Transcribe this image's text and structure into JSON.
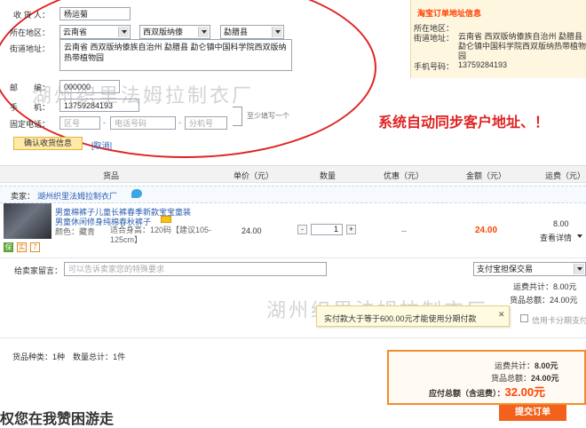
{
  "address_form": {
    "receiver_label": "收 货 人：",
    "receiver_value": "杨运菊",
    "region_label": "所在地区：",
    "province": "云南省",
    "prefecture": "西双版纳傣",
    "county": "勐腊县",
    "street_label": "街道地址：",
    "street_value": "云南省 西双版纳傣族自治州 勐腊县 勐仑镇中国科学院西双版纳热带植物园",
    "postcode_label": "邮　　编：",
    "postcode_value": "000000",
    "mobile_label": "手　　机：",
    "mobile_value": "13759284193",
    "phone_label": "固定电话：",
    "area_code_placeholder": "区号",
    "phone_placeholder": "电话号码",
    "ext_placeholder": "分机号",
    "hint": "至少填写一个",
    "confirm_button": "确认收货信息",
    "cancel_link": "[取消]"
  },
  "taobao_panel": {
    "title": "淘宝订单地址信息",
    "region_label": "所在地区：",
    "street_label": "街道地址：",
    "street_value": "云南省 西双版纳傣族自治州 勐腊县 勐仑镇中国科学院西双版纳热带植物园",
    "mobile_label": "手机号码：",
    "mobile_value": "13759284193"
  },
  "annotation": "系统自动同步客户地址、！",
  "watermark": "湖州织里法姆拉制衣厂",
  "table": {
    "headers": [
      "货品",
      "单价（元）",
      "数量",
      "优惠（元）",
      "金额（元）",
      "运费（元）"
    ],
    "seller_label": "卖家：",
    "seller_name": "湖州织里法姆拉制衣厂"
  },
  "item": {
    "title_line1": "男童棉裤子儿童长裤春季新款宝宝童装",
    "title_line2": "男童休闲修身纯棉春秋裤子",
    "color_label": "颜色：",
    "color_value": "藏青",
    "size_label": "适合身高：",
    "size_value": "120码【建议105-125cm】",
    "badges": [
      "保",
      "实",
      "7"
    ],
    "unit_price": "24.00",
    "quantity": "1",
    "minus": "-",
    "plus": "+",
    "discount": "--",
    "amount": "24.00",
    "shipping": "8.00",
    "details_link": "查看详情"
  },
  "message": {
    "label": "给卖家留言：",
    "placeholder": "可以告诉卖家您的特殊要求"
  },
  "payment": {
    "method": "支付宝担保交易",
    "shipping_total_label": "运费共计：",
    "shipping_total_value": "8.00元",
    "goods_total_label": "货品总额：",
    "goods_total_value": "24.00元",
    "tooltip": "实付款大于等于600.00元才能使用分期付款",
    "tooltip_close": "✕",
    "credit_label": "信用卡分期支付"
  },
  "summary": {
    "kinds_label": "货品种类：",
    "kinds_value": "1种",
    "count_label": "数量总计：",
    "count_value": "1件"
  },
  "total_box": {
    "shipping_label": "运费共计：",
    "shipping_value": "8.00元",
    "goods_label": "货品总额：",
    "goods_value": "24.00元",
    "pay_label": "应付总额（含运费）：",
    "pay_value": "32.00元",
    "submit_button": "提交订单"
  },
  "footer_text": "权您在我赞困游走"
}
